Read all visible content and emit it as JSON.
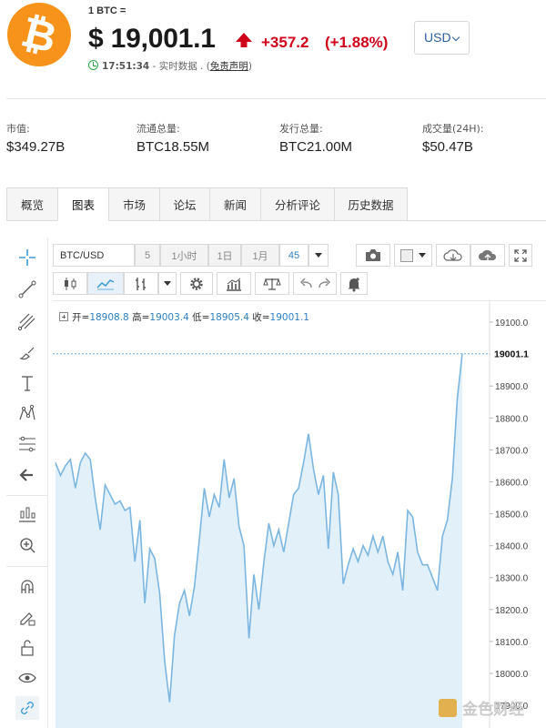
{
  "header": {
    "coin_icon": "bitcoin-logo",
    "coin_symbol_glyph": "₿",
    "unit_label": "1 BTC =",
    "price": "$ 19,001.1",
    "change_abs": "+357.2",
    "change_pct": "(+1.88%)",
    "time": "17:51:34",
    "realtime_text": " - 实时数据 . (",
    "disclaimer_link": "免责声明",
    "disclaimer_close": ")",
    "currency": "USD",
    "up_color": "#d0021b",
    "brand_color": "#f7931a"
  },
  "stats": [
    {
      "label": "市值:",
      "value": "$349.27B"
    },
    {
      "label": "流通总量:",
      "value": "BTC18.55M"
    },
    {
      "label": "发行总量:",
      "value": "BTC21.00M"
    },
    {
      "label": "成交量(24H):",
      "value": "$50.47B"
    }
  ],
  "tabs": [
    {
      "label": "概览",
      "active": false
    },
    {
      "label": "图表",
      "active": true
    },
    {
      "label": "市场",
      "active": false
    },
    {
      "label": "论坛",
      "active": false
    },
    {
      "label": "新闻",
      "active": false
    },
    {
      "label": "分析评论",
      "active": false
    },
    {
      "label": "历史数据",
      "active": false
    }
  ],
  "chart_toolbar": {
    "symbol": "BTC/USD",
    "intervals": [
      "5",
      "1小时",
      "1日",
      "1月",
      "45"
    ]
  },
  "left_tools": [
    "crosshair-icon",
    "trend-line-icon",
    "pitchfork-icon",
    "brush-icon",
    "text-icon",
    "pattern-icon",
    "fib-icon",
    "back-arrow-icon",
    "measure-icon",
    "zoom-icon",
    "magnet-icon",
    "lock-pencil-icon",
    "unlock-icon",
    "eye-icon",
    "link-icon"
  ],
  "ohlc": {
    "open_label": "开=",
    "open": "18908.8",
    "high_label": "高=",
    "high": "19003.4",
    "low_label": "低=",
    "low": "18905.4",
    "close_label": "收=",
    "close": "19001.1"
  },
  "watermark": "金色财经",
  "chart_data": {
    "type": "area",
    "y_ticks": [
      19100.0,
      19000.0,
      18900.0,
      18800.0,
      18700.0,
      18600.0,
      18500.0,
      18400.0,
      18300.0,
      18200.0,
      18100.0,
      18000.0,
      17900.0
    ],
    "y_tick_labels": [
      "19100.0",
      "19000.0",
      "18900.0",
      "18800.0",
      "18700.0",
      "18600.0",
      "18500.0",
      "18400.0",
      "18300.0",
      "18200.0",
      "18100.0",
      "18000.0",
      "17900.0"
    ],
    "ylim": [
      17880,
      19140
    ],
    "current_price": 19001.1,
    "current_label": "19001.1",
    "line_color": "#7bb6e0",
    "fill_color": "#e2f0fa",
    "values": [
      18660,
      18620,
      18650,
      18670,
      18580,
      18660,
      18690,
      18670,
      18550,
      18450,
      18590,
      18560,
      18530,
      18540,
      18510,
      18520,
      18350,
      18480,
      18220,
      18390,
      18360,
      18250,
      18040,
      17910,
      18120,
      18220,
      18260,
      18180,
      18270,
      18420,
      18580,
      18490,
      18560,
      18520,
      18670,
      18550,
      18610,
      18460,
      18400,
      18110,
      18310,
      18200,
      18350,
      18470,
      18400,
      18450,
      18380,
      18470,
      18560,
      18580,
      18660,
      18750,
      18640,
      18560,
      18620,
      18390,
      18630,
      18560,
      18280,
      18340,
      18390,
      18350,
      18400,
      18370,
      18430,
      18380,
      18430,
      18350,
      18310,
      18380,
      18260,
      18510,
      18490,
      18380,
      18340,
      18340,
      18300,
      18260,
      18430,
      18480,
      18610,
      18860,
      19001.1
    ]
  }
}
